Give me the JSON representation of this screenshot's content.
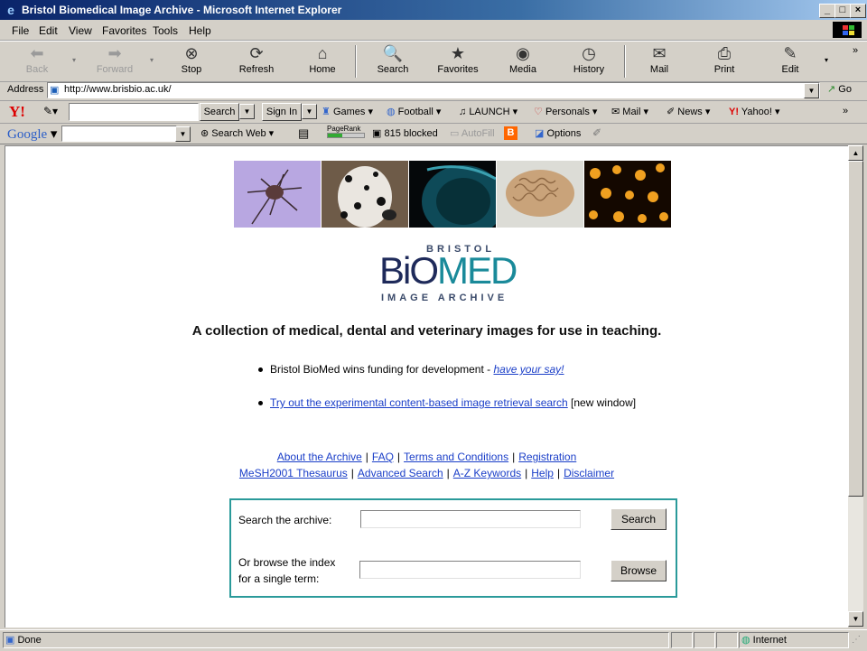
{
  "window": {
    "title": "Bristol Biomedical Image Archive - Microsoft Internet Explorer"
  },
  "menu": [
    "File",
    "Edit",
    "View",
    "Favorites",
    "Tools",
    "Help"
  ],
  "toolbar": {
    "back": "Back",
    "forward": "Forward",
    "stop": "Stop",
    "refresh": "Refresh",
    "home": "Home",
    "search": "Search",
    "favorites": "Favorites",
    "media": "Media",
    "history": "History",
    "mail": "Mail",
    "print": "Print",
    "edit": "Edit"
  },
  "address": {
    "label": "Address",
    "url": "http://www.brisbio.ac.uk/",
    "go": "Go"
  },
  "yahoo": {
    "search_btn": "Search",
    "signin_btn": "Sign In",
    "items": [
      "Games",
      "Football",
      "LAUNCH",
      "Personals",
      "Mail",
      "News",
      "Yahoo!"
    ]
  },
  "google": {
    "logo": "Google",
    "search_web": "Search Web",
    "pagerank": "PageRank",
    "blocked": "815 blocked",
    "autofill": "AutoFill",
    "options": "Options"
  },
  "page": {
    "logo_top": "BRISTOL",
    "logo_main_a": "BiO",
    "logo_main_b": "MED",
    "logo_bottom": "IMAGE ARCHIVE",
    "tagline": "A collection of medical, dental and veterinary images for use in teaching.",
    "bullet1_text": "Bristol BioMed wins funding for development - ",
    "bullet1_link": "have your say!",
    "bullet2_link": "Try out the experimental content-based image retrieval search",
    "bullet2_text": " [new window]",
    "nav_row1": [
      "About the Archive",
      "FAQ",
      "Terms and Conditions",
      "Registration"
    ],
    "nav_row2": [
      "MeSH2001 Thesaurus",
      "Advanced Search",
      "A-Z Keywords",
      "Help",
      "Disclaimer"
    ],
    "search_label": "Search the archive:",
    "search_btn": "Search",
    "browse_label_1": "Or browse the index",
    "browse_label_2": "for a single term:",
    "browse_btn": "Browse"
  },
  "status": {
    "text": "Done",
    "zone": "Internet"
  }
}
